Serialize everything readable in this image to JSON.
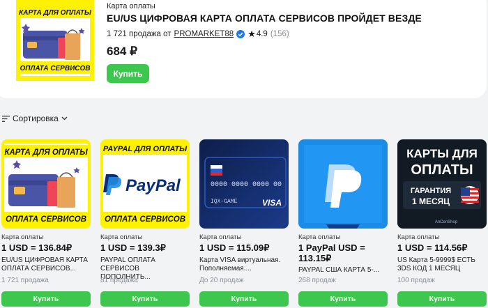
{
  "featured": {
    "category": "Карта оплаты",
    "title": "EU/US ЦИФРОВАЯ КАРТА ОПЛАТА СЕРВИСОВ ПРОЙДЕТ ВЕЗДЕ",
    "sales_text": "1 721 продажа от",
    "seller": "PROMARKET88",
    "rating": "4.9",
    "reviews": "(156)",
    "price": "684 ₽",
    "buy_label": "Купить",
    "image_top_text": "КАРТА ДЛЯ ОПЛАТЫ",
    "image_bottom_text": "ОПЛАТА СЕРВИСОВ"
  },
  "sort": {
    "label": "Сортировка"
  },
  "products": [
    {
      "category": "Карта оплаты",
      "price": "1 USD = 136.84₽",
      "description": "EU/US ЦИФРОВАЯ КАРТА ОПЛАТА СЕРВИСОВ...",
      "sales": "1 721 продажа",
      "buy_label": "Купить",
      "image_top_text": "КАРТА ДЛЯ ОПЛАТЫ",
      "image_bottom_text": "ОПЛАТА СЕРВИСОВ"
    },
    {
      "category": "Карта оплаты",
      "price": "1 USD = 139.3₽",
      "description": "PAYPAL ОПЛАТА СЕРВИСОВ ПОПОЛНИТЬ...",
      "sales": "81 продажа",
      "buy_label": "Купить",
      "image_top_text": "PAYPAL ДЛЯ ОПЛАТЫ",
      "image_bottom_text": "ОПЛАТА СЕРВИСОВ",
      "image_brand": "PayPal"
    },
    {
      "category": "Карта оплаты",
      "price": "1 USD = 115.09₽",
      "description": "Карта VISA виртуальная. Пополняемая....",
      "sales": "До 20 продаж",
      "buy_label": "Купить",
      "image_card_number": "0000 0000 0000 00",
      "image_card_name": "IQX-GAME",
      "image_card_brand": "VISA"
    },
    {
      "category": "Карта оплаты",
      "price": "1 PayPal USD = 113.15₽",
      "description": "PAYPAL США КАРТА 5-...",
      "sales": "268 продаж",
      "buy_label": "Купить"
    },
    {
      "category": "Карта оплаты",
      "price": "1 USD = 114.56₽",
      "description": "US Карта 5-9999$ ЕСТЬ 3DS КОД 1 МЕСЯЦ",
      "sales": "100 продаж",
      "buy_label": "Купить",
      "image_title_1": "КАРТЫ ДЛЯ",
      "image_title_2": "ОПЛАТЫ",
      "image_badge_1": "ГАРАНТИЯ",
      "image_badge_2": "1 МЕСЯЦ",
      "image_shop": "AnCenShop"
    }
  ],
  "colors": {
    "accent_green": "#3ec74e",
    "verified_blue": "#1f7ae8",
    "yellow": "#fff200"
  }
}
